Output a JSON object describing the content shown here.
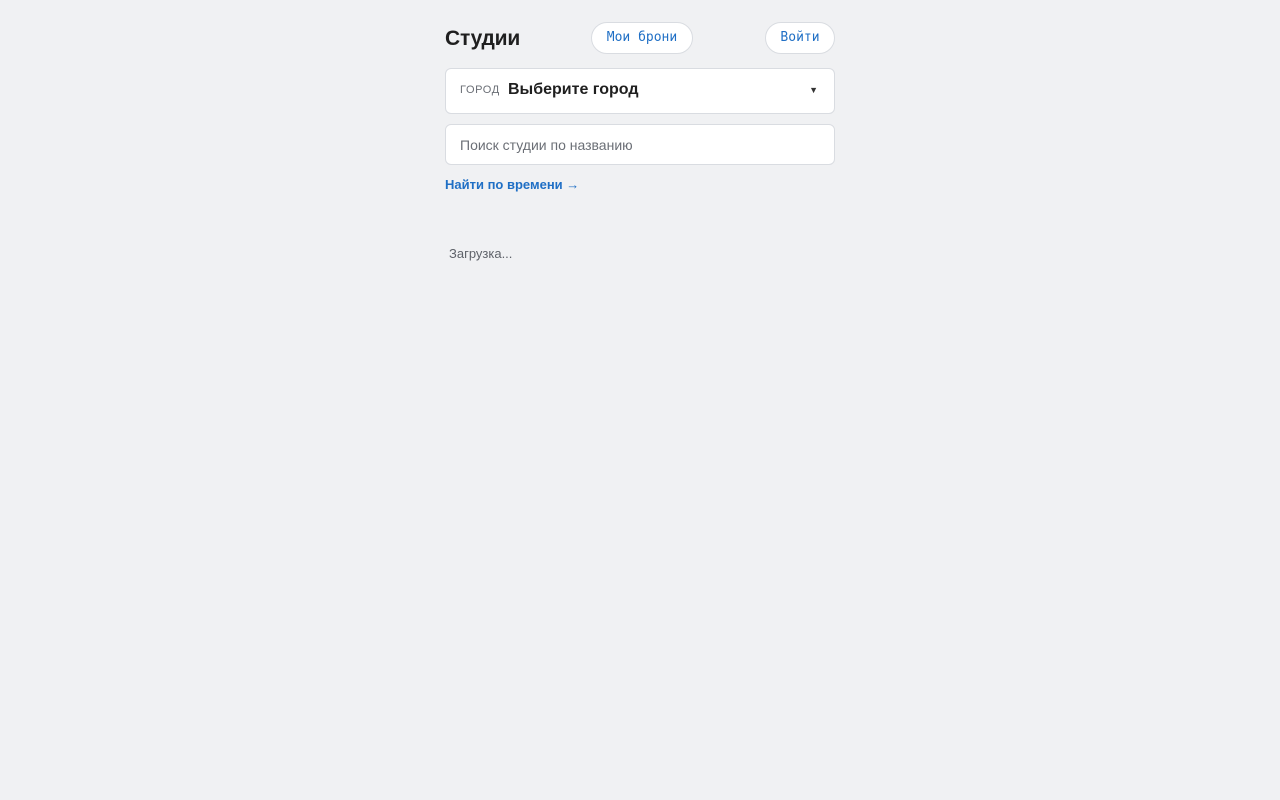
{
  "header": {
    "title": "Студии",
    "bookings_label": "Мои брони",
    "login_label": "Войти"
  },
  "city": {
    "label": "ГОРОД",
    "value": "Выберите город",
    "chevron": "▼"
  },
  "search": {
    "placeholder": "Поиск студии по названию",
    "value": ""
  },
  "time_link": "Найти по времени →",
  "status": "Загрузка..."
}
